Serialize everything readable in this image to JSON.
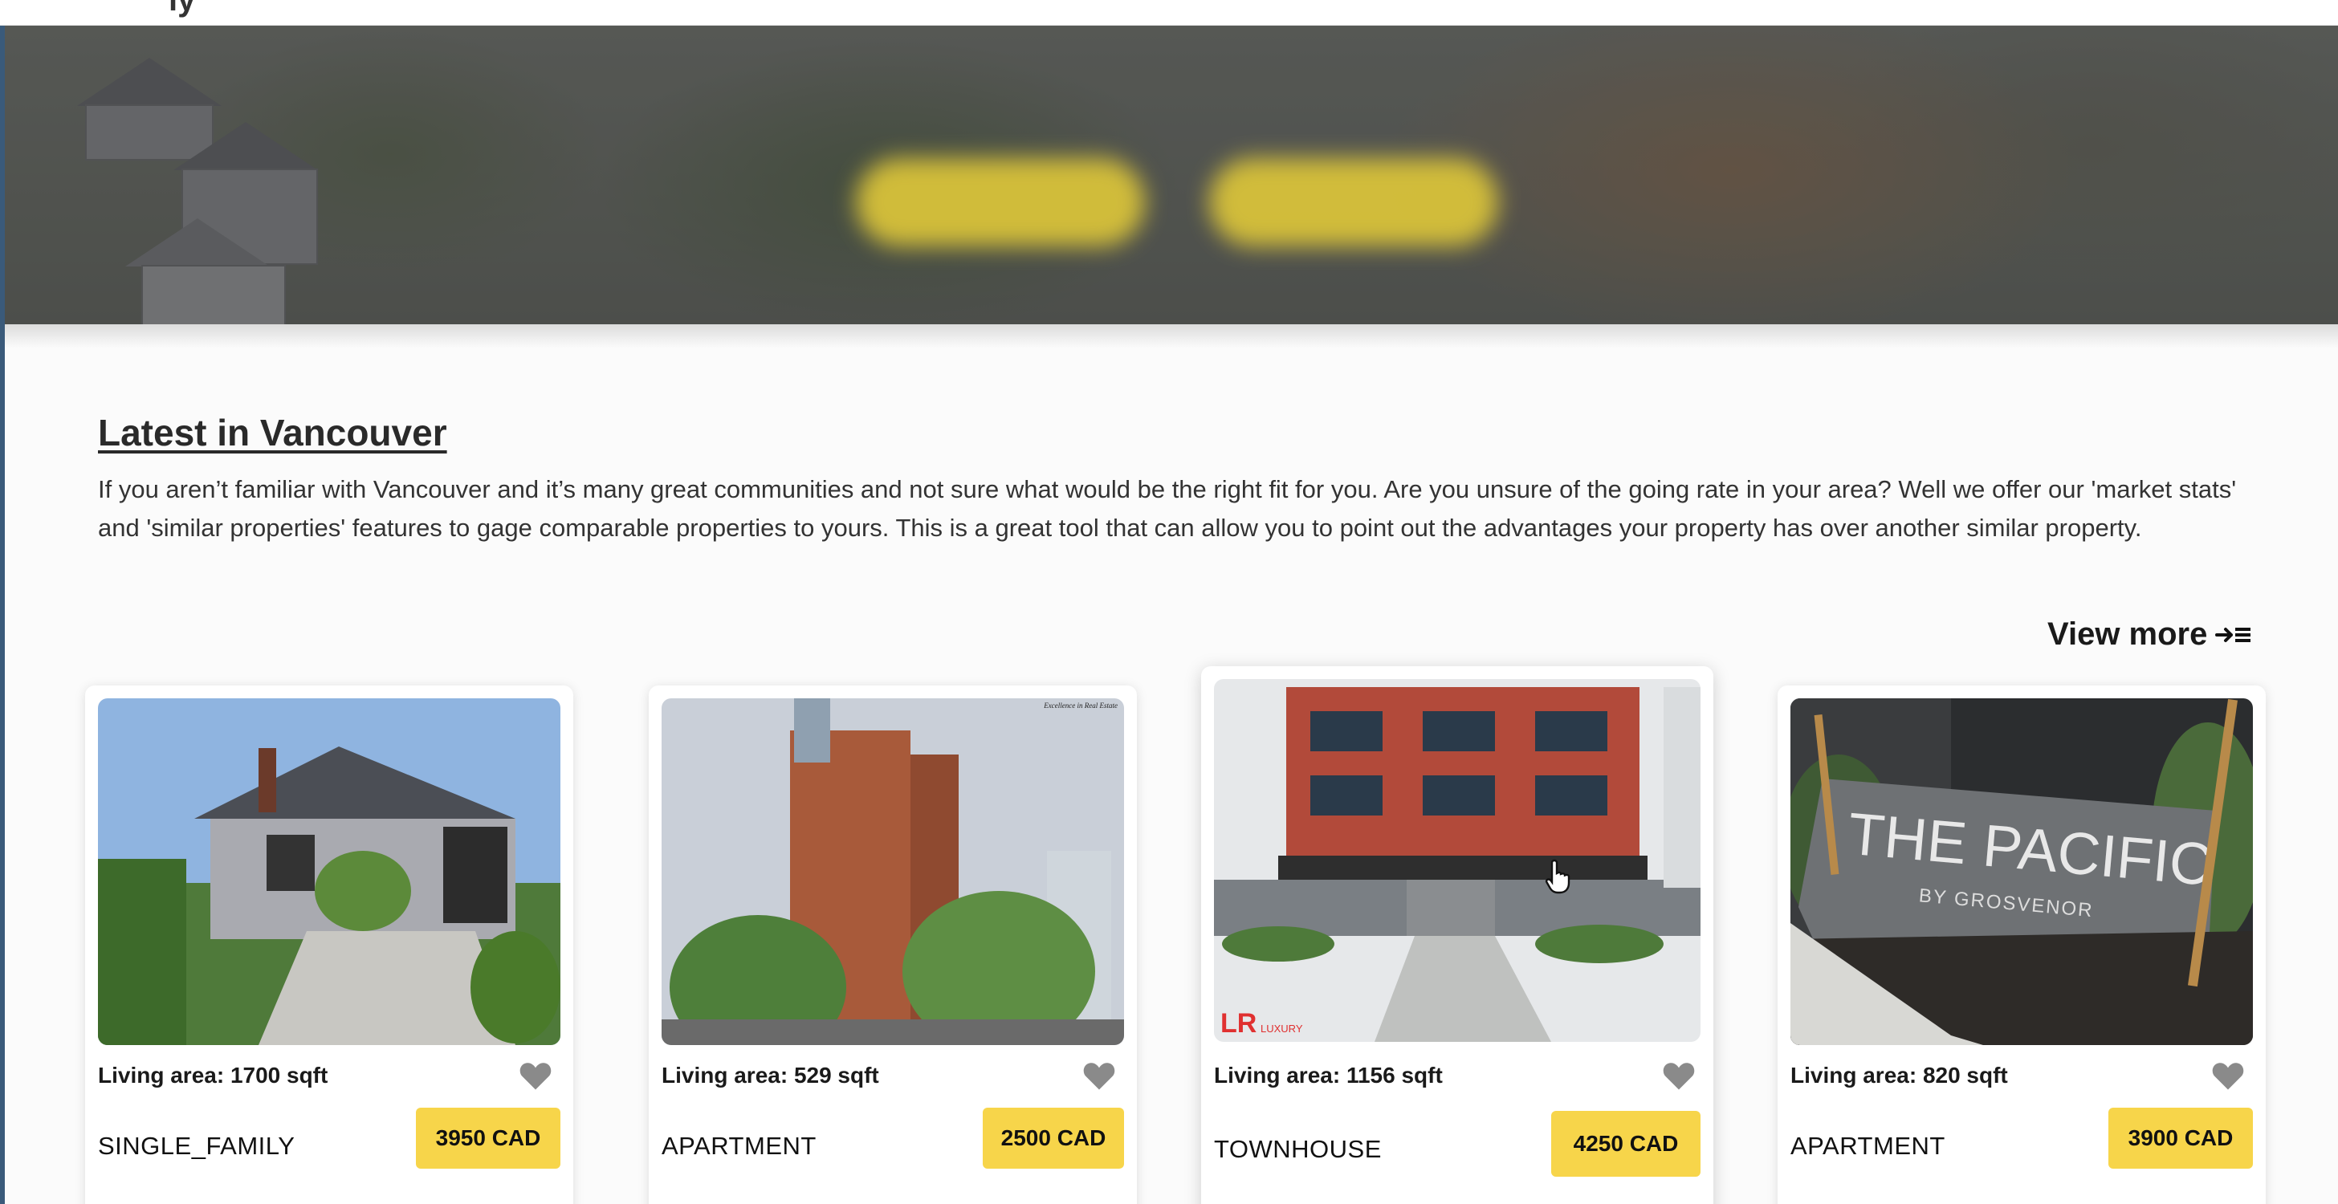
{
  "header": {
    "logo_fragment": "ly"
  },
  "hero": {
    "primary_action": "",
    "secondary_action": ""
  },
  "section": {
    "title": "Latest in Vancouver",
    "description": "If you aren’t familiar with Vancouver and it’s many great communities and not sure what would be the right fit for you. Are you unsure of the going rate in your area? Well we offer our 'market stats' and 'similar properties' features to gage comparable properties to yours. This is a great tool that can allow you to point out the advantages your property has over another similar property.",
    "view_more_label": "View more"
  },
  "listings": [
    {
      "living_area": "Living area: 1700 sqft",
      "type": "SINGLE_FAMILY",
      "price": "3950 CAD",
      "image_icon": "house-photo"
    },
    {
      "living_area": "Living area: 529 sqft",
      "type": "APARTMENT",
      "price": "2500 CAD",
      "image_icon": "tower-photo",
      "watermark": "Excellence in Real Estate"
    },
    {
      "living_area": "Living area: 1156 sqft",
      "type": "TOWNHOUSE",
      "price": "4250 CAD",
      "image_icon": "townhouse-photo",
      "watermark": "LR LUXURY"
    },
    {
      "living_area": "Living area: 820 sqft",
      "type": "APARTMENT",
      "price": "3900 CAD",
      "image_icon": "building-sign-photo",
      "sign_text": "THE PACIFIC",
      "sign_subtext": "BY GROSVENOR"
    }
  ],
  "colors": {
    "accent": "#f7d54a",
    "heart": "#8a8a8a",
    "text": "#1a1a1a"
  }
}
